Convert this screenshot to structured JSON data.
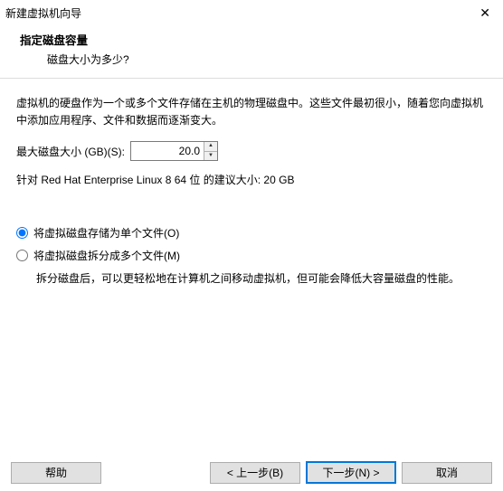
{
  "window": {
    "title": "新建虚拟机向导",
    "close": "✕"
  },
  "header": {
    "heading": "指定磁盘容量",
    "sub": "磁盘大小为多少?"
  },
  "intro": {
    "line1": "虚拟机的硬盘作为一个或多个文件存储在主机的物理磁盘中。这些文件最初很小，随着您向虚拟机中添加应用程序、文件和数据而逐渐变大。"
  },
  "size": {
    "label": "最大磁盘大小 (GB)(S):",
    "value": "20.0",
    "recommend": "针对 Red Hat Enterprise Linux 8 64 位 的建议大小: 20 GB"
  },
  "radios": {
    "single": "将虚拟磁盘存储为单个文件(O)",
    "split": "将虚拟磁盘拆分成多个文件(M)",
    "split_desc": "拆分磁盘后，可以更轻松地在计算机之间移动虚拟机，但可能会降低大容量磁盘的性能。"
  },
  "buttons": {
    "help": "帮助",
    "back": "< 上一步(B)",
    "next": "下一步(N) >",
    "cancel": "取消"
  }
}
